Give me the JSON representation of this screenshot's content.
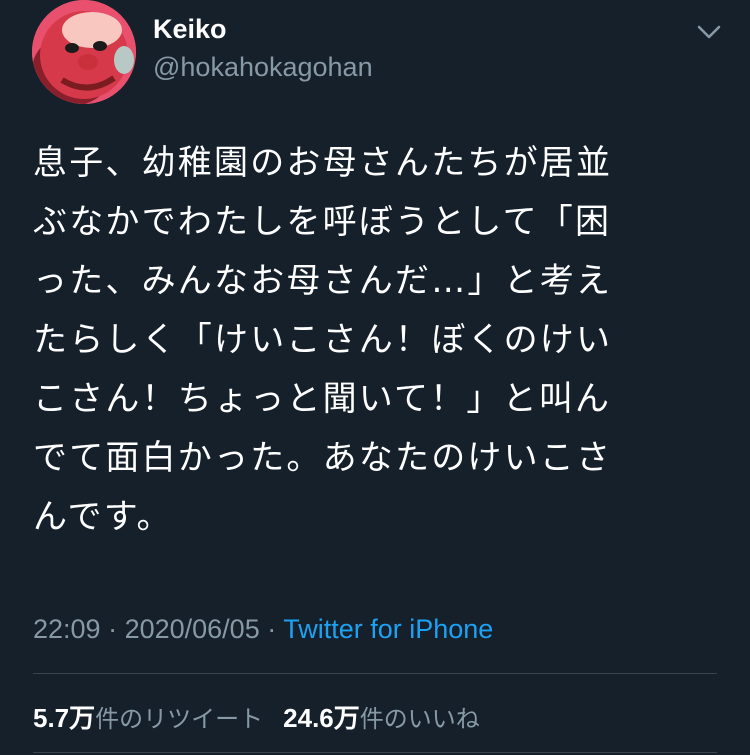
{
  "author": {
    "display_name": "Keiko",
    "handle": "@hokahokagohan",
    "avatar_icon": "red-toy-character-avatar"
  },
  "menu": {
    "icon": "chevron-down-icon"
  },
  "tweet": {
    "lines": [
      "息子、幼稚園のお母さんたちが居並",
      "ぶなかでわたしを呼ぼうとして「困",
      "った、みんなお母さんだ…」と考え",
      "たらしく「けいこさん！ぼくのけい",
      "こさん！ちょっと聞いて！」と叫ん",
      "でて面白かった。あなたのけいこさ",
      "んです。"
    ],
    "time": "22:09",
    "date": "2020/06/05",
    "separator": " · ",
    "source": "Twitter for iPhone"
  },
  "stats": {
    "retweets_count": "5.7万",
    "retweets_label": "件のリツイート",
    "likes_count": "24.6万",
    "likes_label": "件のいいね"
  },
  "colors": {
    "background": "#15202b",
    "text": "#ffffff",
    "secondary": "#8899a6",
    "link": "#1da1f2",
    "divider": "#38444d"
  }
}
